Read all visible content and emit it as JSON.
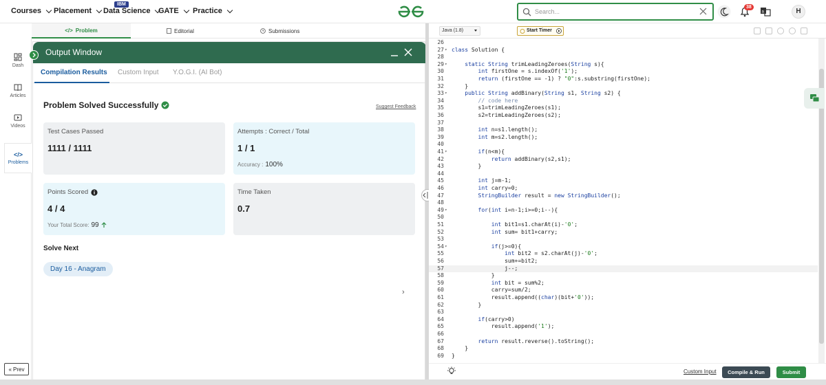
{
  "nav": {
    "items": [
      {
        "label": "Courses"
      },
      {
        "label": "Placement"
      },
      {
        "label": "Data Science",
        "badge": "IBM"
      },
      {
        "label": "GATE"
      },
      {
        "label": "Practice"
      }
    ],
    "search_placeholder": "Search...",
    "notification_count": "38",
    "avatar_initial": "H"
  },
  "problem_tabs": [
    "Problem",
    "Editorial",
    "Submissions"
  ],
  "siderail": {
    "items": [
      {
        "label": "Dash",
        "icon": "dashboard-icon"
      },
      {
        "label": "Articles",
        "icon": "book-icon"
      },
      {
        "label": "Videos",
        "icon": "video-icon"
      },
      {
        "label": "Problems",
        "icon": "code-icon"
      }
    ],
    "prev_label": "Prev"
  },
  "output_window": {
    "title": "Output Window",
    "tabs": [
      "Compilation Results",
      "Custom Input",
      "Y.O.G.I. (AI Bot)"
    ],
    "result_title": "Problem Solved Successfully",
    "suggest_feedback": "Suggest Feedback",
    "cards": {
      "test_cases": {
        "label": "Test Cases Passed",
        "value": "1111 / 1111"
      },
      "attempts": {
        "label": "Attempts : Correct / Total",
        "value": "1 / 1",
        "sub_label": "Accuracy :",
        "sub_value": "100%"
      },
      "points": {
        "label": "Points Scored",
        "value": "4 / 4",
        "sub_label": "Your Total Score:",
        "sub_value": "99"
      },
      "time": {
        "label": "Time Taken",
        "value": "0.7"
      }
    },
    "solve_next_label": "Solve Next",
    "solve_next_chip": "Day 16 - Anagram"
  },
  "editor": {
    "language": "Java (1.8)",
    "timer_label": "Start Timer",
    "current_line": 57,
    "lines": [
      {
        "n": 26,
        "fold": false,
        "code": ""
      },
      {
        "n": 27,
        "fold": true,
        "code": "class Solution {"
      },
      {
        "n": 28,
        "fold": false,
        "code": ""
      },
      {
        "n": 29,
        "fold": true,
        "code": "    static String trimLeadingZeroes(String s){"
      },
      {
        "n": 30,
        "fold": false,
        "code": "        int firstOne = s.indexOf('1');"
      },
      {
        "n": 31,
        "fold": false,
        "code": "        return (firstOne == -1) ? \"0\":s.substring(firstOne);"
      },
      {
        "n": 32,
        "fold": false,
        "code": "    }"
      },
      {
        "n": 33,
        "fold": true,
        "code": "    public String addBinary(String s1, String s2) {"
      },
      {
        "n": 34,
        "fold": false,
        "code": "        // code here"
      },
      {
        "n": 35,
        "fold": false,
        "code": "        s1=trimLeadingZeroes(s1);"
      },
      {
        "n": 36,
        "fold": false,
        "code": "        s2=trimLeadingZeroes(s2);"
      },
      {
        "n": 37,
        "fold": false,
        "code": ""
      },
      {
        "n": 38,
        "fold": false,
        "code": "        int n=s1.length();"
      },
      {
        "n": 39,
        "fold": false,
        "code": "        int m=s2.length();"
      },
      {
        "n": 40,
        "fold": false,
        "code": ""
      },
      {
        "n": 41,
        "fold": true,
        "code": "        if(n<m){"
      },
      {
        "n": 42,
        "fold": false,
        "code": "            return addBinary(s2,s1);"
      },
      {
        "n": 43,
        "fold": false,
        "code": "        }"
      },
      {
        "n": 44,
        "fold": false,
        "code": ""
      },
      {
        "n": 45,
        "fold": false,
        "code": "        int j=m-1;"
      },
      {
        "n": 46,
        "fold": false,
        "code": "        int carry=0;"
      },
      {
        "n": 47,
        "fold": false,
        "code": "        StringBuilder result = new StringBuilder();"
      },
      {
        "n": 48,
        "fold": false,
        "code": ""
      },
      {
        "n": 49,
        "fold": true,
        "code": "        for(int i=n-1;i>=0;i--){"
      },
      {
        "n": 50,
        "fold": false,
        "code": ""
      },
      {
        "n": 51,
        "fold": false,
        "code": "            int bit1=s1.charAt(i)-'0';"
      },
      {
        "n": 52,
        "fold": false,
        "code": "            int sum= bit1+carry;"
      },
      {
        "n": 53,
        "fold": false,
        "code": ""
      },
      {
        "n": 54,
        "fold": true,
        "code": "            if(j>=0){"
      },
      {
        "n": 55,
        "fold": false,
        "code": "                int bit2 = s2.charAt(j)-'0';"
      },
      {
        "n": 56,
        "fold": false,
        "code": "                sum+=bit2;"
      },
      {
        "n": 57,
        "fold": false,
        "code": "                j--;"
      },
      {
        "n": 58,
        "fold": false,
        "code": "            }"
      },
      {
        "n": 59,
        "fold": false,
        "code": "            int bit = sum%2;"
      },
      {
        "n": 60,
        "fold": false,
        "code": "            carry=sum/2;"
      },
      {
        "n": 61,
        "fold": false,
        "code": "            result.append((char)(bit+'0'));"
      },
      {
        "n": 62,
        "fold": false,
        "code": "        }"
      },
      {
        "n": 63,
        "fold": false,
        "code": ""
      },
      {
        "n": 64,
        "fold": false,
        "code": "        if(carry>0)"
      },
      {
        "n": 65,
        "fold": false,
        "code": "            result.append('1');"
      },
      {
        "n": 66,
        "fold": false,
        "code": ""
      },
      {
        "n": 67,
        "fold": false,
        "code": "        return result.reverse().toString();"
      },
      {
        "n": 68,
        "fold": false,
        "code": "    }"
      },
      {
        "n": 69,
        "fold": false,
        "code": "}"
      }
    ],
    "custom_input_label": "Custom Input",
    "compile_label": "Compile & Run",
    "submit_label": "Submit"
  },
  "colors": {
    "brand_green": "#2f8d46",
    "header_green": "#2f6b4f",
    "link_blue": "#1a5c9e",
    "card_blue": "#e8f6fb",
    "card_gray": "#eef0f2"
  }
}
